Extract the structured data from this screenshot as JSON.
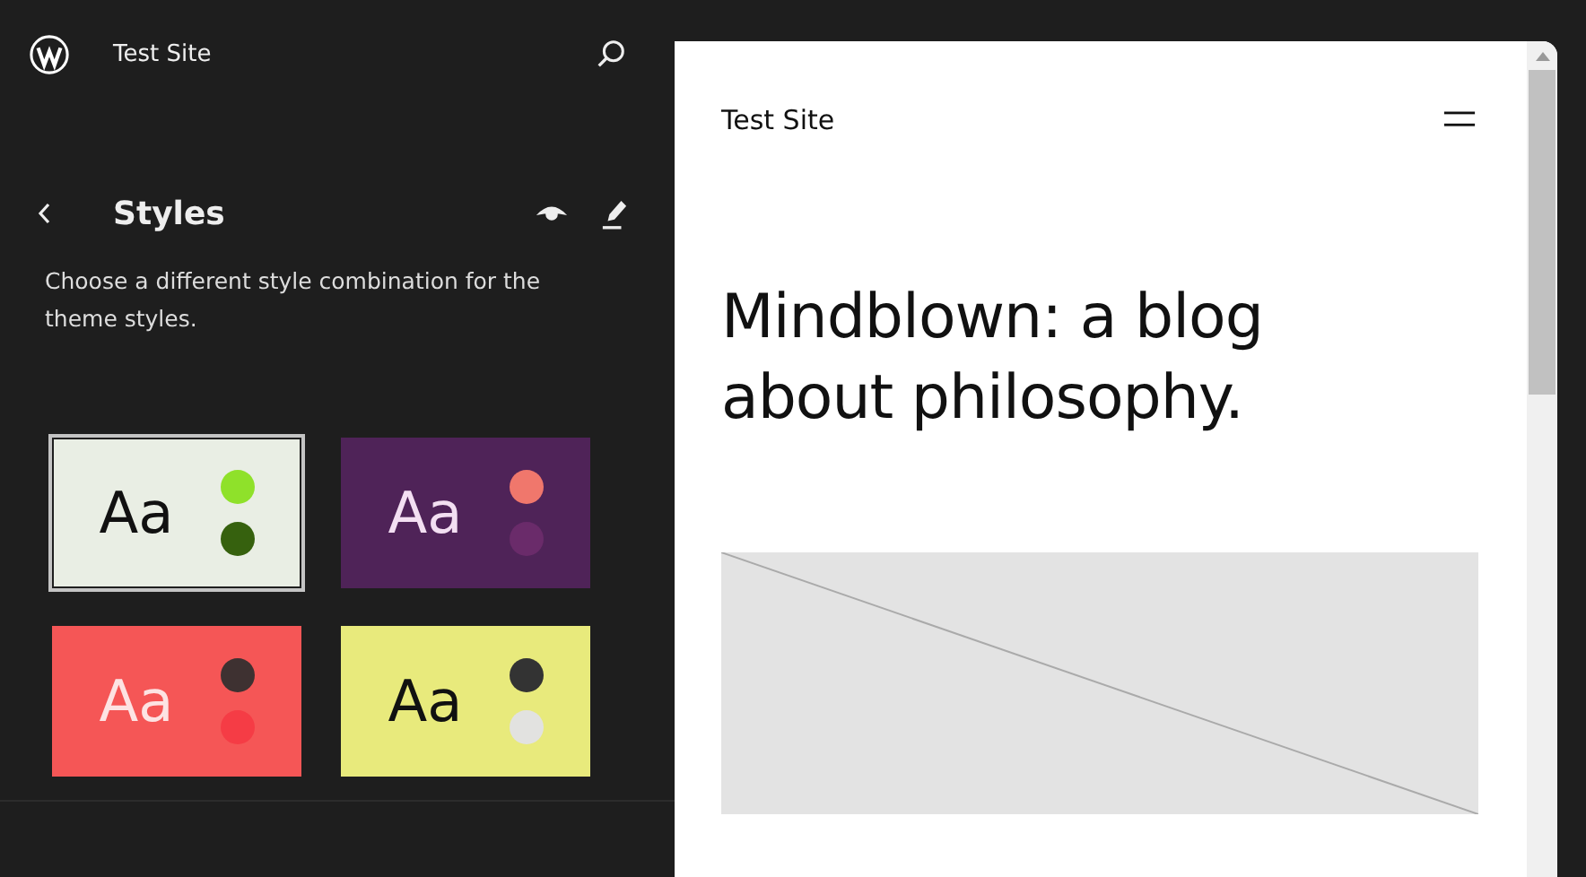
{
  "sidebar": {
    "site_title": "Test Site",
    "heading": "Styles",
    "description": "Choose a different style combination for the theme styles.",
    "variations": [
      {
        "sample": {
          "text": "Aa",
          "color": "#111111"
        },
        "selected": true,
        "color": "#e9eee4",
        "dots": [
          {
            "color": "#8fe12a"
          },
          {
            "color": "#36610e"
          }
        ]
      },
      {
        "sample": {
          "text": "Aa",
          "color": "#f3dff2"
        },
        "selected": false,
        "color": "#4f2358",
        "dots": [
          {
            "color": "#f0776c"
          },
          {
            "color": "#6a2b6a"
          }
        ]
      },
      {
        "sample": {
          "text": "Aa",
          "color": "#fde3e3"
        },
        "selected": false,
        "color": "#f55656",
        "dots": [
          {
            "color": "#3e3131"
          },
          {
            "color": "#f53c45"
          }
        ]
      },
      {
        "sample": {
          "text": "Aa",
          "color": "#111111"
        },
        "selected": false,
        "color": "#e8ea7c",
        "dots": [
          {
            "color": "#333333"
          },
          {
            "color": "#e2e2e0"
          }
        ]
      }
    ]
  },
  "preview": {
    "site_title": "Test Site",
    "heading": "Mindblown: a blog about philosophy."
  }
}
